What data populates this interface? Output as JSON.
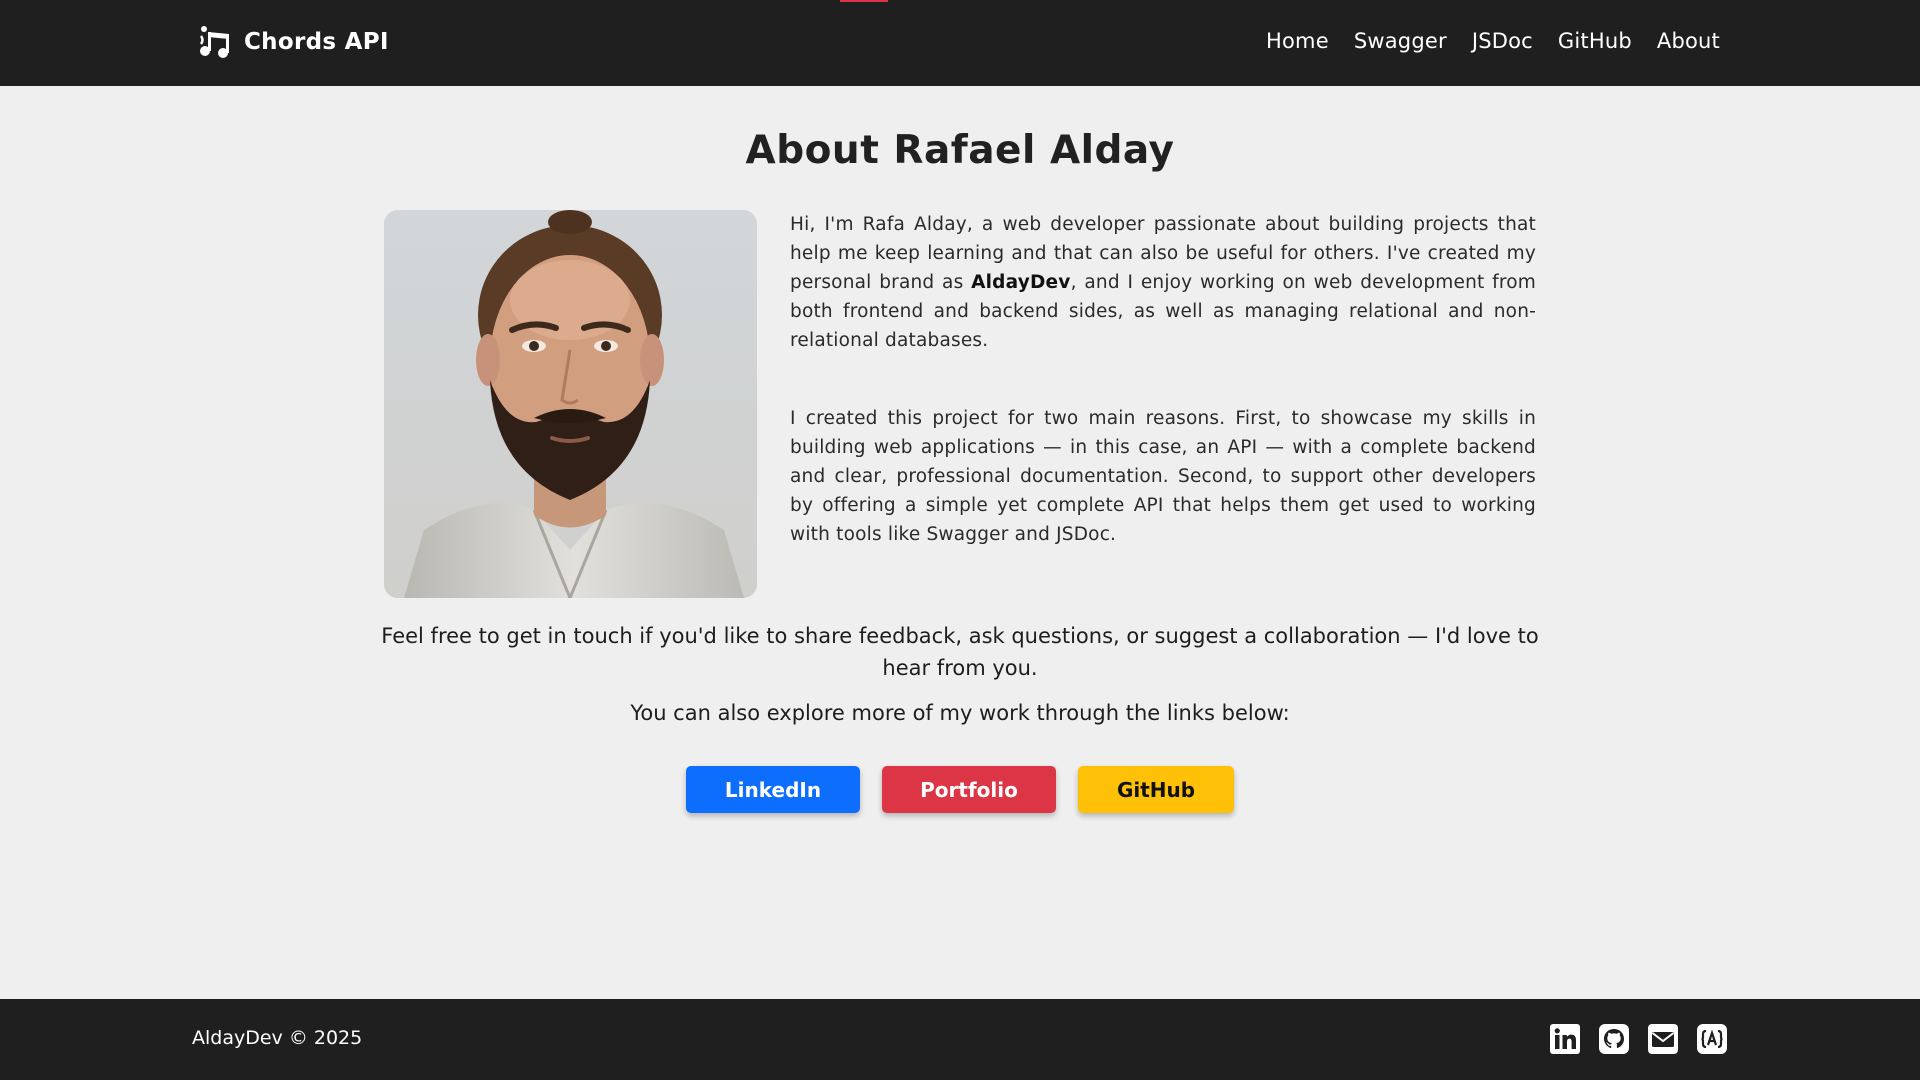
{
  "header": {
    "brand": "Chords API",
    "nav": [
      "Home",
      "Swagger",
      "JSDoc",
      "GitHub",
      "About"
    ]
  },
  "main": {
    "title": "About Rafael Alday",
    "bio": {
      "p1_before": "Hi, I'm Rafa Alday, a web developer passionate about building projects that help me keep learning and that can also be useful for others. I've created my personal brand as ",
      "p1_brand": "AldayDev",
      "p1_after": ", and I enjoy working on web development from both frontend and backend sides, as well as managing relational and non-relational databases.",
      "p2": "I created this project for two main reasons. First, to showcase my skills in building web applications — in this case, an API — with a complete backend and clear, professional documentation. Second, to support other developers by offering a simple yet complete API that helps them get used to working with tools like Swagger and JSDoc."
    },
    "contact_text": "Feel free to get in touch if you'd like to share feedback, ask questions, or suggest a collaboration — I'd love to hear from you.",
    "explore_text": "You can also explore more of my work through the links below:",
    "buttons": {
      "linkedin": "LinkedIn",
      "portfolio": "Portfolio",
      "github": "GitHub"
    },
    "button_colors": {
      "linkedin": "#0d6efd",
      "portfolio": "#dc3545",
      "github": "#ffc107"
    }
  },
  "footer": {
    "copyright": "AldayDev © 2025",
    "icons": [
      "linkedin-icon",
      "github-icon",
      "mail-icon",
      "portfolio-icon"
    ]
  },
  "colors": {
    "header_bg": "#1f1f1f",
    "page_bg": "#efefef",
    "accent": "#dc3545"
  }
}
